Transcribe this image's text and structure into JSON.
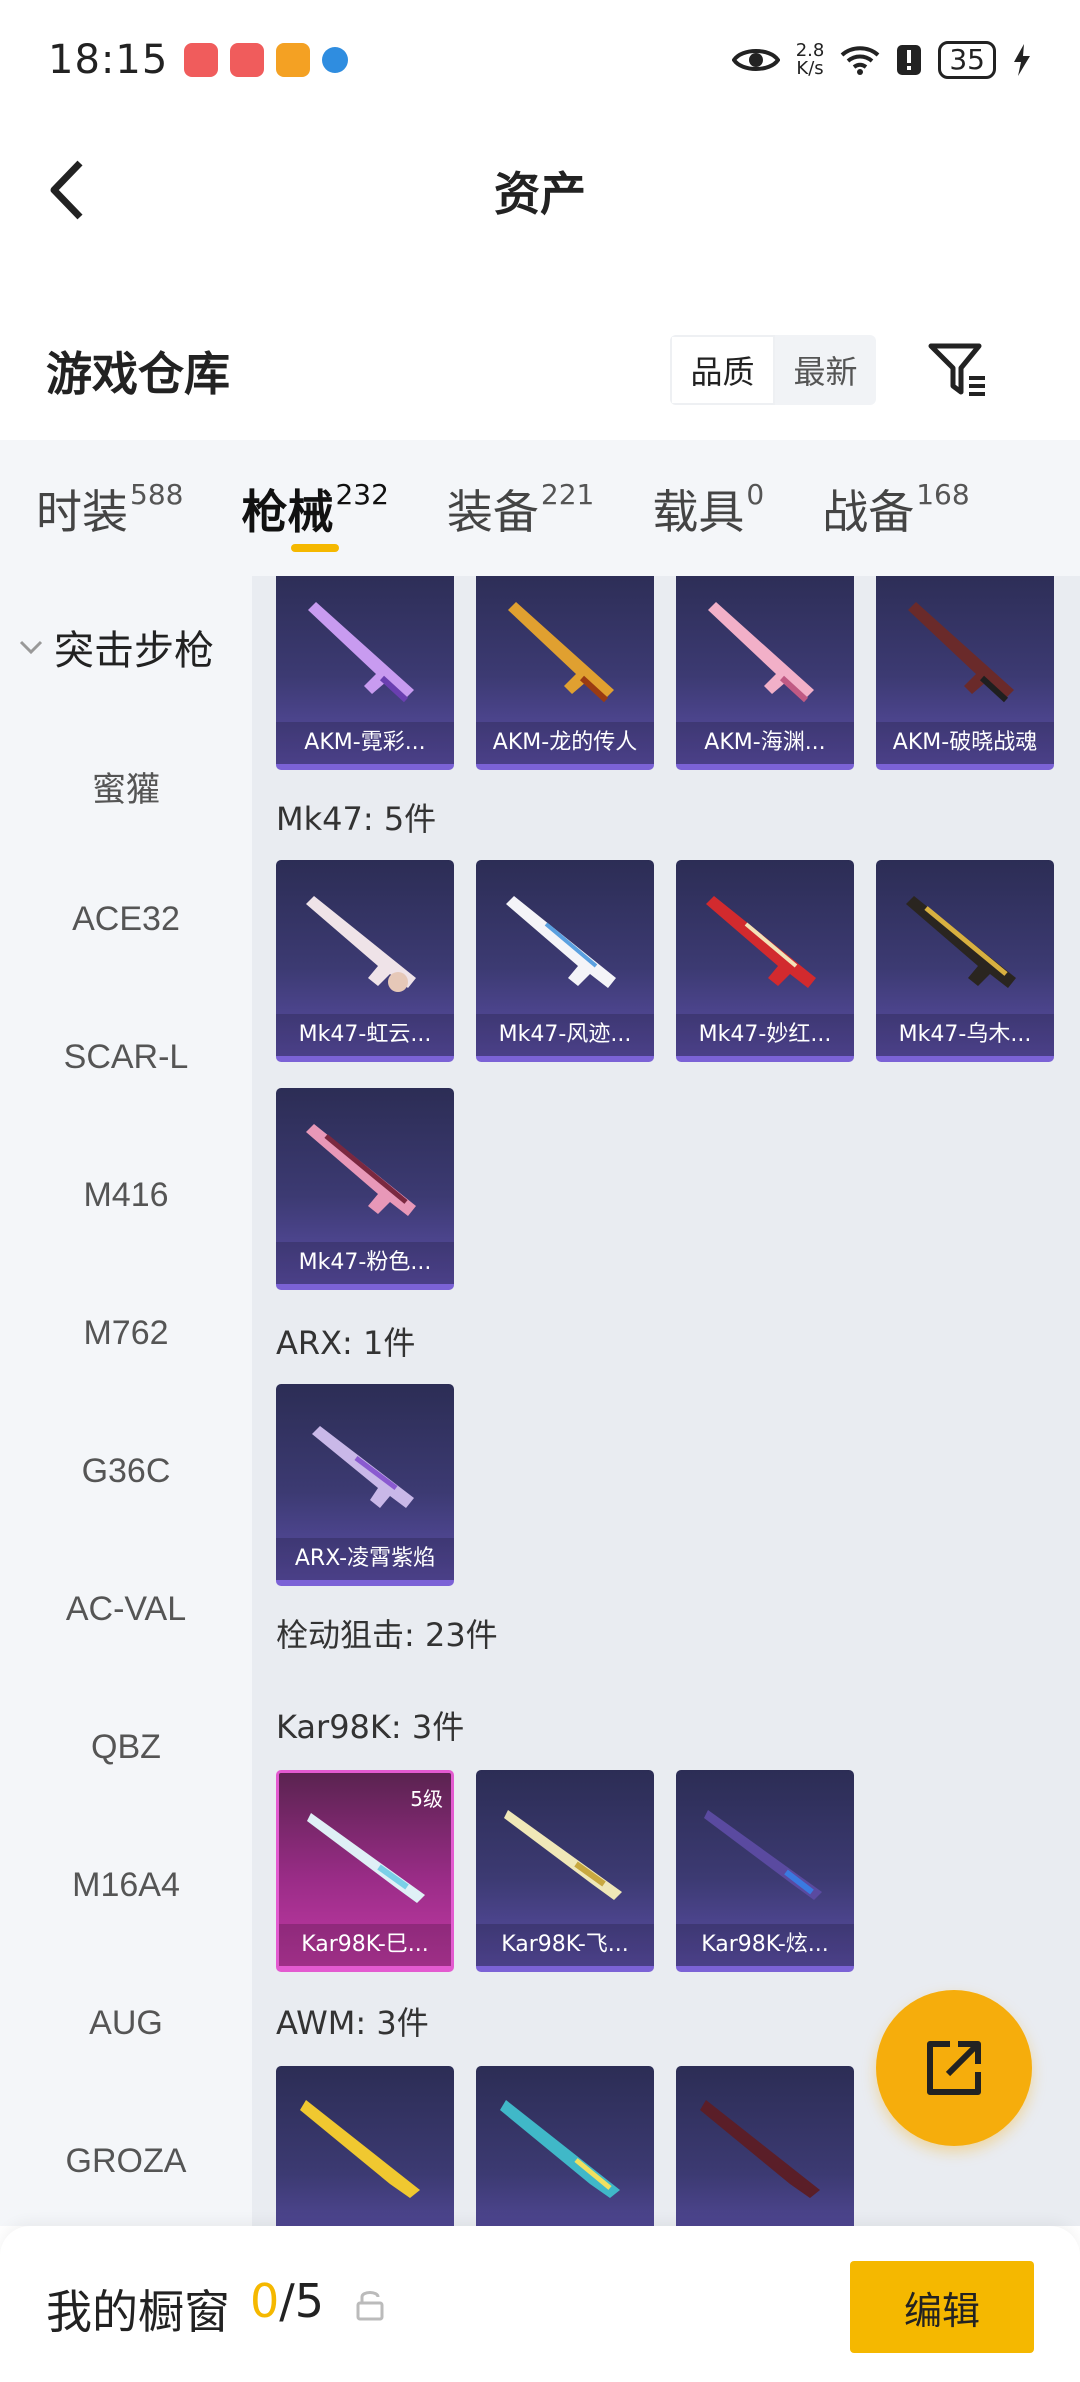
{
  "status_bar": {
    "time": "18:15",
    "net_speed_value": "2.8",
    "net_speed_unit": "K/s",
    "battery": "35",
    "app_icons": [
      "#f05c5c",
      "#f05c5c",
      "#f4a123",
      "#2f8de0"
    ]
  },
  "header": {
    "title": "资产"
  },
  "warehouse": {
    "title": "游戏仓库",
    "sort_options": [
      "品质",
      "最新"
    ],
    "sort_active": "品质"
  },
  "tabs": [
    {
      "label": "时装",
      "count": "588"
    },
    {
      "label": "枪械",
      "count": "232"
    },
    {
      "label": "装备",
      "count": "221"
    },
    {
      "label": "载具",
      "count": "0"
    },
    {
      "label": "战备",
      "count": "168"
    }
  ],
  "active_tab": "枪械",
  "sidebar": {
    "category": "突击步枪",
    "items": [
      "蜜獾",
      "ACE32",
      "SCAR-L",
      "M416",
      "M762",
      "G36C",
      "AC-VAL",
      "QBZ",
      "M16A4",
      "AUG",
      "GROZA"
    ]
  },
  "content": {
    "akm_cards": [
      "AKM-霓彩...",
      "AKM-龙的传人",
      "AKM-海渊...",
      "AKM-破晓战魂"
    ],
    "mk47_title": "Mk47: 5件",
    "mk47_cards": [
      "Mk47-虹云...",
      "Mk47-风迹...",
      "Mk47-妙红...",
      "Mk47-乌木...",
      "Mk47-粉色..."
    ],
    "arx_title": "ARX: 1件",
    "arx_cards": [
      "ARX-凌霄紫焰"
    ],
    "bolt_title": "栓动狙击: 23件",
    "kar_title": "Kar98K: 3件",
    "kar_cards": [
      "Kar98K-巳...",
      "Kar98K-飞...",
      "Kar98K-炫..."
    ],
    "kar_level": "5级",
    "awm_title": "AWM: 3件"
  },
  "bottom_bar": {
    "title": "我的橱窗",
    "current": "0",
    "separator": "/",
    "max": "5",
    "edit_label": "编辑"
  },
  "colors": {
    "accent": "#f5b800",
    "fab": "#f6ad0c",
    "card_base": "#3c3a72",
    "card_highlight": "#c23aa5"
  },
  "icons": [
    "back-arrow-icon",
    "filter-icon",
    "chevron-down-icon",
    "external-link-icon",
    "lock-icon",
    "eye-icon",
    "wifi-icon",
    "alert-icon",
    "battery-icon",
    "charging-icon"
  ]
}
